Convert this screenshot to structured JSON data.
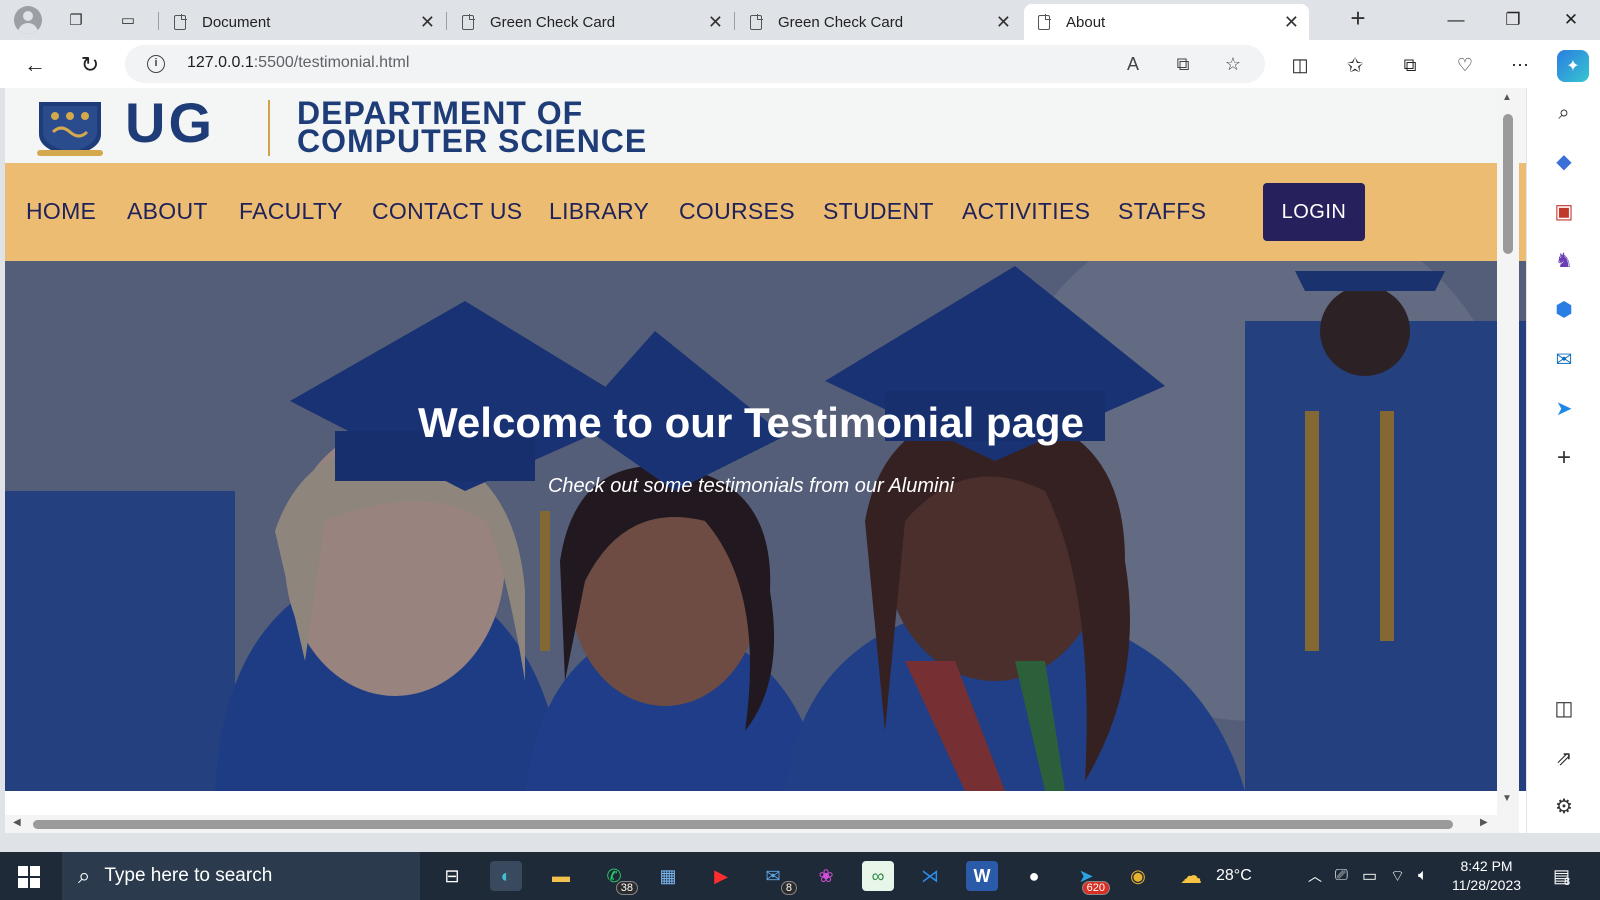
{
  "browser": {
    "tabs": [
      {
        "title": "Document"
      },
      {
        "title": "Green Check Card"
      },
      {
        "title": "Green Check Card"
      },
      {
        "title": "About",
        "active": true
      }
    ],
    "url_host": "127.0.0.1",
    "url_path": ":5500/testimonial.html"
  },
  "site": {
    "logo_text": "UG",
    "dept_line1": "DEPARTMENT OF",
    "dept_line2": "COMPUTER SCIENCE",
    "nav": [
      "HOME",
      "ABOUT",
      "FACULTY",
      "CONTACT US",
      "LIBRARY",
      "COURSES",
      "STUDENT",
      "ACTIVITIES",
      "STAFFS"
    ],
    "login_label": "LOGIN",
    "hero_title": "Welcome to our Testimonial page",
    "hero_subtitle": "Check out some testimonials from our Alumini"
  },
  "taskbar": {
    "search_placeholder": "Type here to search",
    "whatsapp_badge": "38",
    "mail_badge": "8",
    "telegram_badge": "620",
    "temperature": "28°C",
    "time": "8:42 PM",
    "date": "11/28/2023",
    "notification_count": "8"
  },
  "colors": {
    "nav_bg": "#ebbc72",
    "brand_blue": "#1e3c78",
    "login_bg": "#26215c",
    "taskbar_bg": "#1e2a38"
  }
}
